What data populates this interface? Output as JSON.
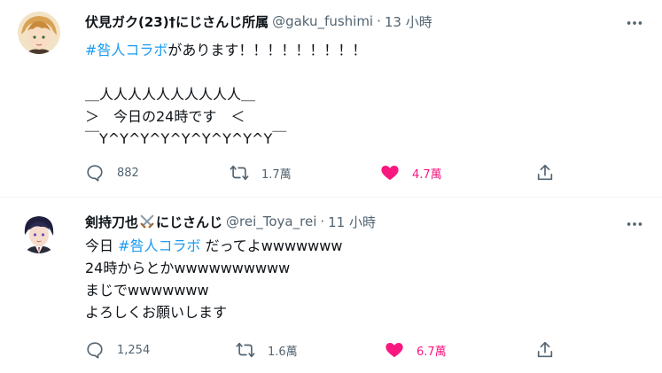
{
  "tweets": [
    {
      "display_name": "伏見ガク(23)†にじさんじ所属",
      "handle": "@gaku_fushimi",
      "separator": "·",
      "time": "13 小時",
      "hashtag": "#咎人コラボ",
      "first_line_rest": "があります！！！！！！！！！",
      "body_rest": "\n\n＿人人人人人人人人人人＿\n＞　今日の24時です　＜\n￣Y^Y^Y^Y^Y^Y^Y^Y^Y￣",
      "replies": "882",
      "retweets": "1.7萬",
      "likes": "4.7萬",
      "liked": true
    },
    {
      "display_name": "剣持刀也",
      "display_name_suffix": "にじさんじ",
      "handle": "@rei_Toya_rei",
      "separator": "·",
      "time": "11 小時",
      "first_line_prefix": "今日 ",
      "hashtag": "#咎人コラボ",
      "first_line_rest": " だってよwwwwwww",
      "body_rest": "\n24時からとかwwwwwwwwww\nまじでwwwwwww\nよろしくお願いします",
      "replies": "1,254",
      "retweets": "1.6萬",
      "likes": "6.7萬",
      "liked": true
    }
  ],
  "icons": {
    "more": "more-dots-icon",
    "reply": "reply-bubble-icon",
    "retweet": "retweet-arrows-icon",
    "like": "heart-icon",
    "share": "share-upload-icon",
    "cross": "crossed-swords-emoji"
  },
  "colors": {
    "link": "#1d9bf0",
    "like_active": "#f91880",
    "secondary_text": "#536471",
    "primary_text": "#0f1419",
    "divider": "#eff3f4"
  }
}
